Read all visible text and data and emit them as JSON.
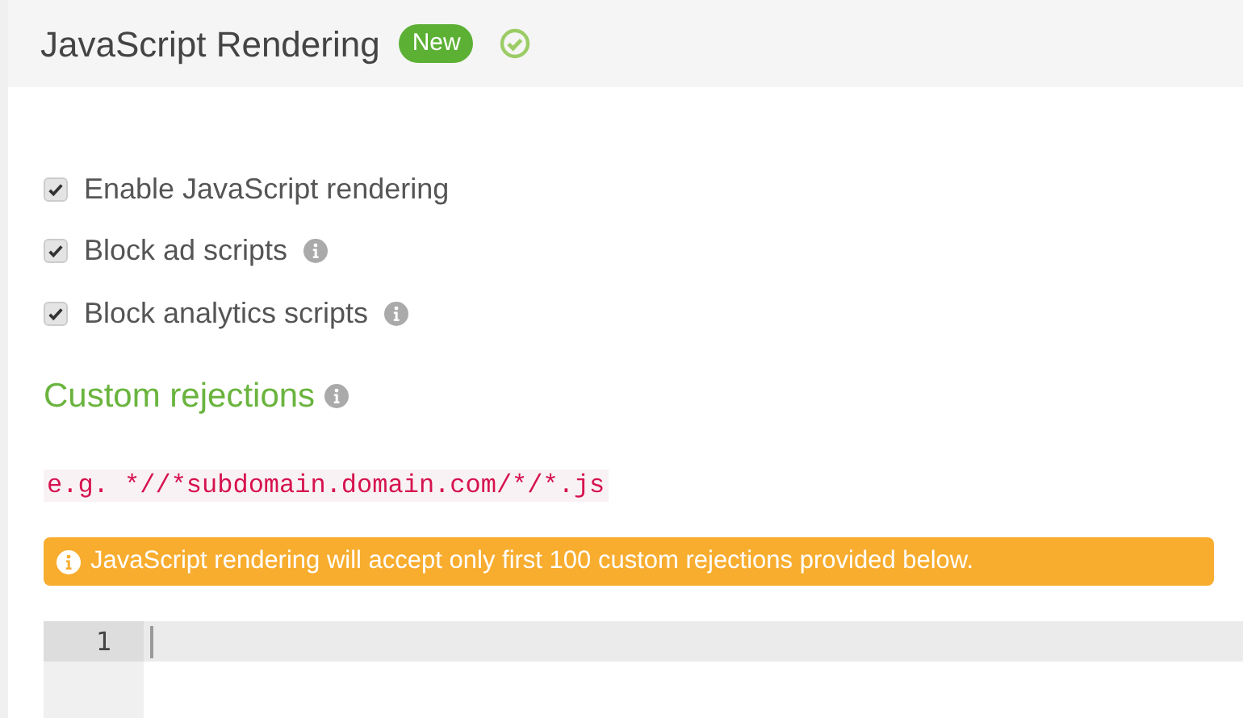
{
  "header": {
    "title": "JavaScript Rendering",
    "badge": "New"
  },
  "options": [
    {
      "label": "Enable JavaScript rendering",
      "checked": true,
      "info": false
    },
    {
      "label": "Block ad scripts",
      "checked": true,
      "info": true
    },
    {
      "label": "Block analytics scripts",
      "checked": true,
      "info": true
    }
  ],
  "custom_rejections": {
    "heading": "Custom rejections",
    "example": "e.g. *//*subdomain.domain.com/*/*.js",
    "notice": "JavaScript rendering will accept only first 100 custom rejections provided below."
  },
  "editor": {
    "line_numbers": [
      "1"
    ]
  }
}
